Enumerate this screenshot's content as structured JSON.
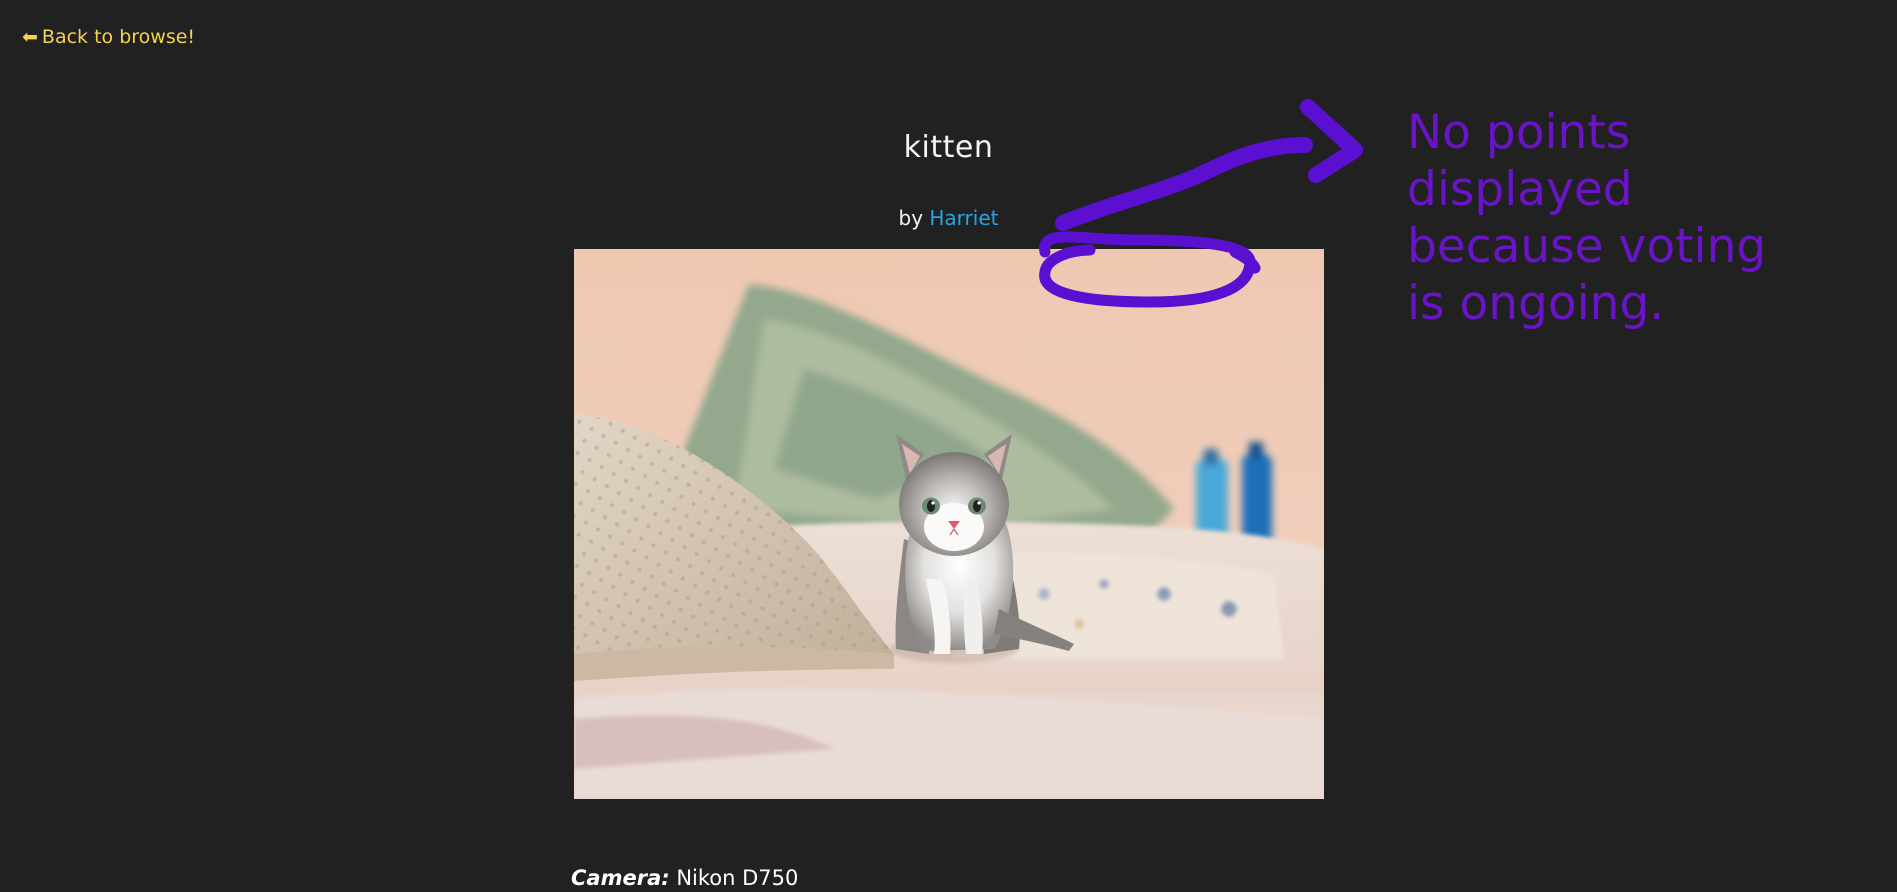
{
  "nav": {
    "back_arrow": "🠔",
    "back_label": "Back to browse!"
  },
  "photo": {
    "title": "kitten",
    "by_prefix": "by",
    "author": "Harriet",
    "image_subject": "photo-kitten-on-bed"
  },
  "details": {
    "camera_label": "Camera:",
    "camera_value": "Nikon D750"
  },
  "annotation": {
    "text": "No points displayed because voting is ongoing.",
    "color": "#6a13c9"
  },
  "colors": {
    "background": "#212121",
    "back_link": "#f5d251",
    "author_link": "#29a3e8",
    "text": "#f4f4f4"
  }
}
